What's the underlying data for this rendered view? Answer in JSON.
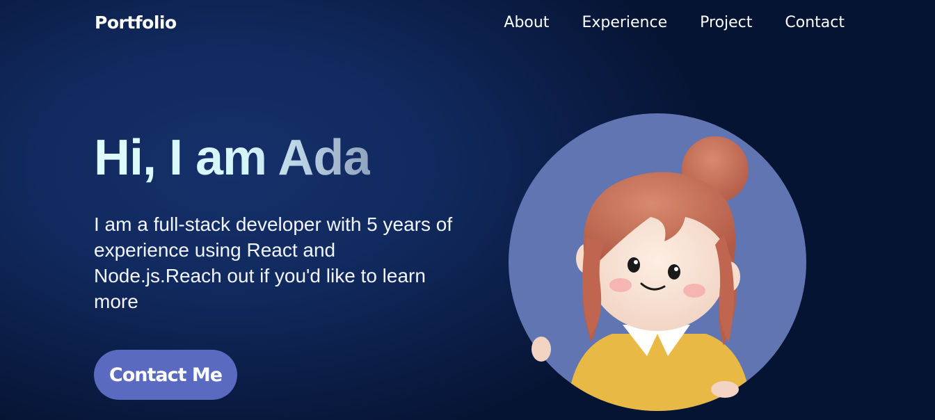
{
  "header": {
    "logo": "Portfolio",
    "nav": [
      {
        "label": "About"
      },
      {
        "label": "Experience"
      },
      {
        "label": "Project"
      },
      {
        "label": "Contact"
      }
    ]
  },
  "hero": {
    "title": "Hi, I am Ada",
    "description": "I am a full-stack developer with 5 years of experience using React and Node.js.Reach out if you'd like to learn more",
    "cta_label": "Contact Me"
  },
  "colors": {
    "background": "#0d1f4d",
    "accent": "#5a6ac0",
    "avatar_circle": "#6175b3",
    "title_gradient": "#dffbff"
  }
}
